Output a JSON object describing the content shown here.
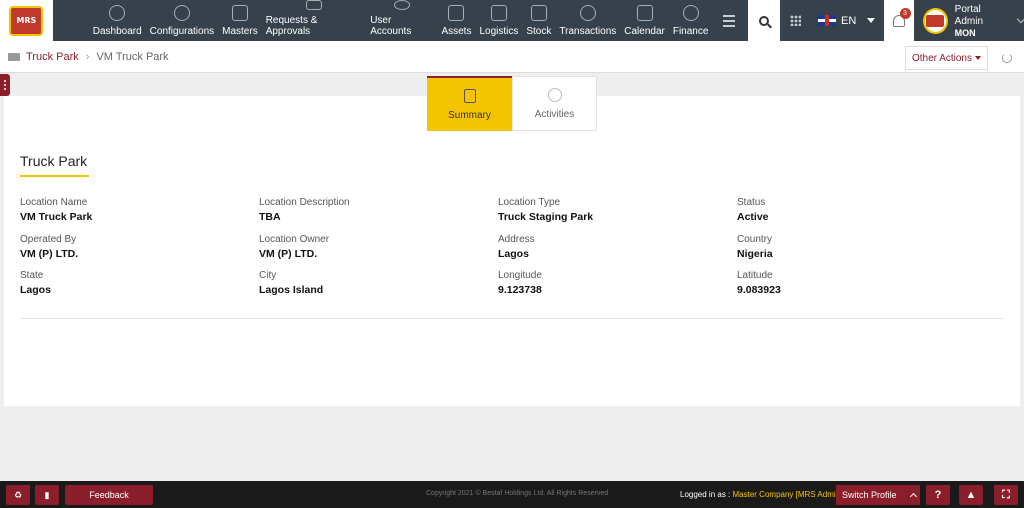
{
  "brand": {
    "logo_text": "MRS"
  },
  "nav": {
    "items": [
      {
        "label": "Dashboard"
      },
      {
        "label": "Configurations"
      },
      {
        "label": "Masters"
      },
      {
        "label": "Requests & Approvals"
      },
      {
        "label": "User Accounts"
      },
      {
        "label": "Assets"
      },
      {
        "label": "Logistics"
      },
      {
        "label": "Stock"
      },
      {
        "label": "Transactions"
      },
      {
        "label": "Calendar"
      },
      {
        "label": "Finance"
      }
    ],
    "language": "EN",
    "notification_count": "3",
    "user": {
      "name": "Portal Admin",
      "sub": "MON"
    }
  },
  "breadcrumb": {
    "parent": "Truck Park",
    "current": "VM Truck Park"
  },
  "other_actions_label": "Other Actions",
  "tabs": [
    {
      "label": "Summary",
      "active": true
    },
    {
      "label": "Activities",
      "active": false
    }
  ],
  "panel": {
    "title": "Truck Park",
    "fields": [
      [
        {
          "label": "Location Name",
          "value": "VM Truck Park"
        },
        {
          "label": "Location Description",
          "value": "TBA"
        },
        {
          "label": "Location Type",
          "value": "Truck Staging Park"
        },
        {
          "label": "Status",
          "value": "Active"
        }
      ],
      [
        {
          "label": "Operated By",
          "value": "VM (P) LTD."
        },
        {
          "label": "Location Owner",
          "value": "VM (P) LTD."
        },
        {
          "label": "Address",
          "value": "Lagos"
        },
        {
          "label": "Country",
          "value": "Nigeria"
        }
      ],
      [
        {
          "label": "State",
          "value": "Lagos"
        },
        {
          "label": "City",
          "value": "Lagos Island"
        },
        {
          "label": "Longitude",
          "value": "9.123738"
        },
        {
          "label": "Latitude",
          "value": "9.083923"
        }
      ]
    ]
  },
  "footer": {
    "feedback_label": "Feedback",
    "copyright": "Copyright 2021 © Bestaf Holdings Ltd. All Rights Reserved",
    "logged_in_label": "Logged in as :",
    "company": "Master Company [MRS Admin]",
    "switch_profile": "Switch Profile",
    "help_label": "?"
  },
  "colors": {
    "accent": "#8b1e2b",
    "highlight": "#f5c400",
    "nav_bg": "#37414b"
  }
}
